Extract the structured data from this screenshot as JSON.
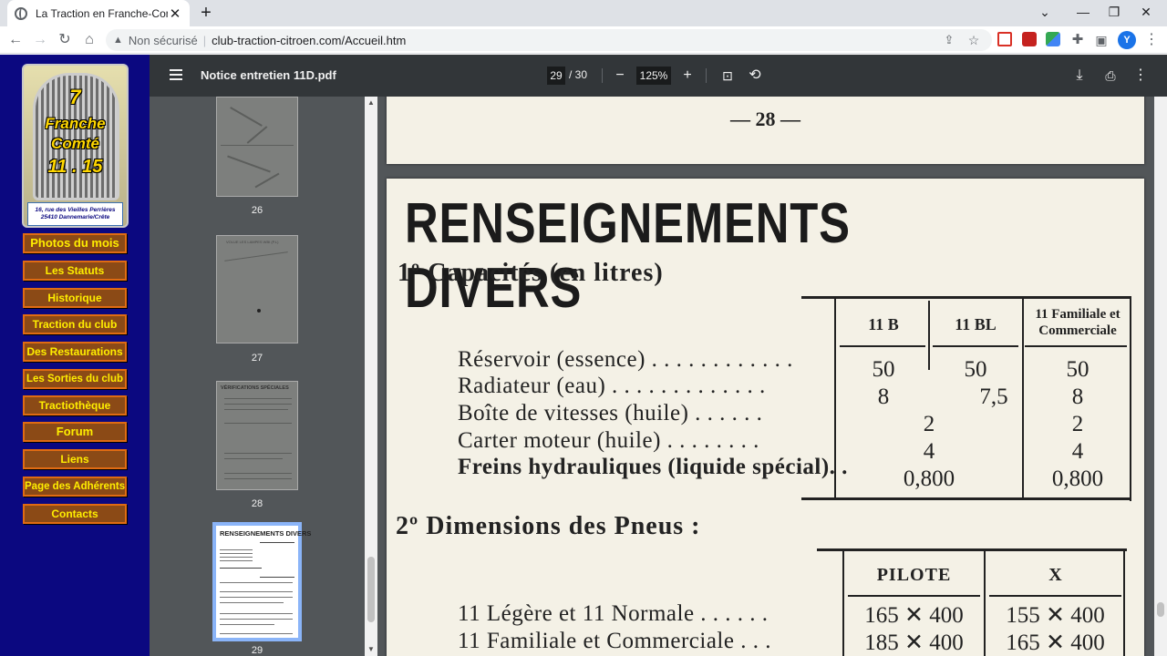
{
  "browser": {
    "tab_title": "La Traction en Franche-Comté",
    "security_label": "Non sécurisé",
    "url": "club-traction-citroen.com/Accueil.htm",
    "avatar_initial": "Y"
  },
  "site": {
    "logo": {
      "line1": "7",
      "line2": "Franche",
      "line3": "Comté",
      "line4": "11 . 15",
      "address1": "16, rue des Vieilles Perrières",
      "address2": "25410 Dannemarie/Crête"
    },
    "menu": [
      "Photos du mois",
      "Les Statuts",
      "Historique",
      "Traction du club",
      "Des Restaurations",
      "Les Sorties du club",
      "Tractiothèque",
      "Forum",
      "Liens",
      "Page des Adhérents",
      "Contacts"
    ]
  },
  "pdf": {
    "file_name": "Notice entretien 11D.pdf",
    "current_page": "29",
    "total_pages": "/ 30",
    "zoom": "125%",
    "thumbnails": [
      "26",
      "27",
      "28",
      "29"
    ],
    "thumb_texts": {
      "t27_head": "VOLUE LES LAMPES WBI (P.L)",
      "t28_head": "VÉRIFICATIONS SPÉCIALES",
      "t29_head": "RENSEIGNEMENTS DIVERS"
    },
    "prev_page_number": "— 28 —",
    "page": {
      "title": "RENSEIGNEMENTS DIVERS",
      "section1": "1º Capacités (en litres)",
      "columns": [
        "11 B",
        "11 BL",
        "11 Familiale et Commerciale"
      ],
      "capacity_rows": [
        {
          "label": "Réservoir (essence) . . . . . . . . . . . .",
          "values": [
            "50",
            "50",
            "50"
          ]
        },
        {
          "label": "Radiateur (eau) . . . . . . . . . . . . .",
          "values": [
            "8",
            "7,5",
            "8"
          ]
        },
        {
          "label": "Boîte de vitesses (huile) . . . . . .",
          "values": [
            "2",
            "2"
          ]
        },
        {
          "label": "Carter moteur (huile) . . . . . . . .",
          "values": [
            "4",
            "4"
          ]
        },
        {
          "label": "Freins hydrauliques (liquide spécial). .",
          "values": [
            "0,800",
            "0,800"
          ]
        }
      ],
      "section2": "2º Dimensions des Pneus :",
      "tyre_columns": [
        "PILOTE",
        "X"
      ],
      "tyre_rows": [
        {
          "label": "11 Légère et 11 Normale . . . . . .",
          "values": [
            "165 ✕ 400",
            "155 ✕ 400"
          ]
        },
        {
          "label": "11 Familiale et Commerciale . . .",
          "values": [
            "185 ✕ 400",
            "165 ✕ 400"
          ]
        }
      ]
    }
  }
}
